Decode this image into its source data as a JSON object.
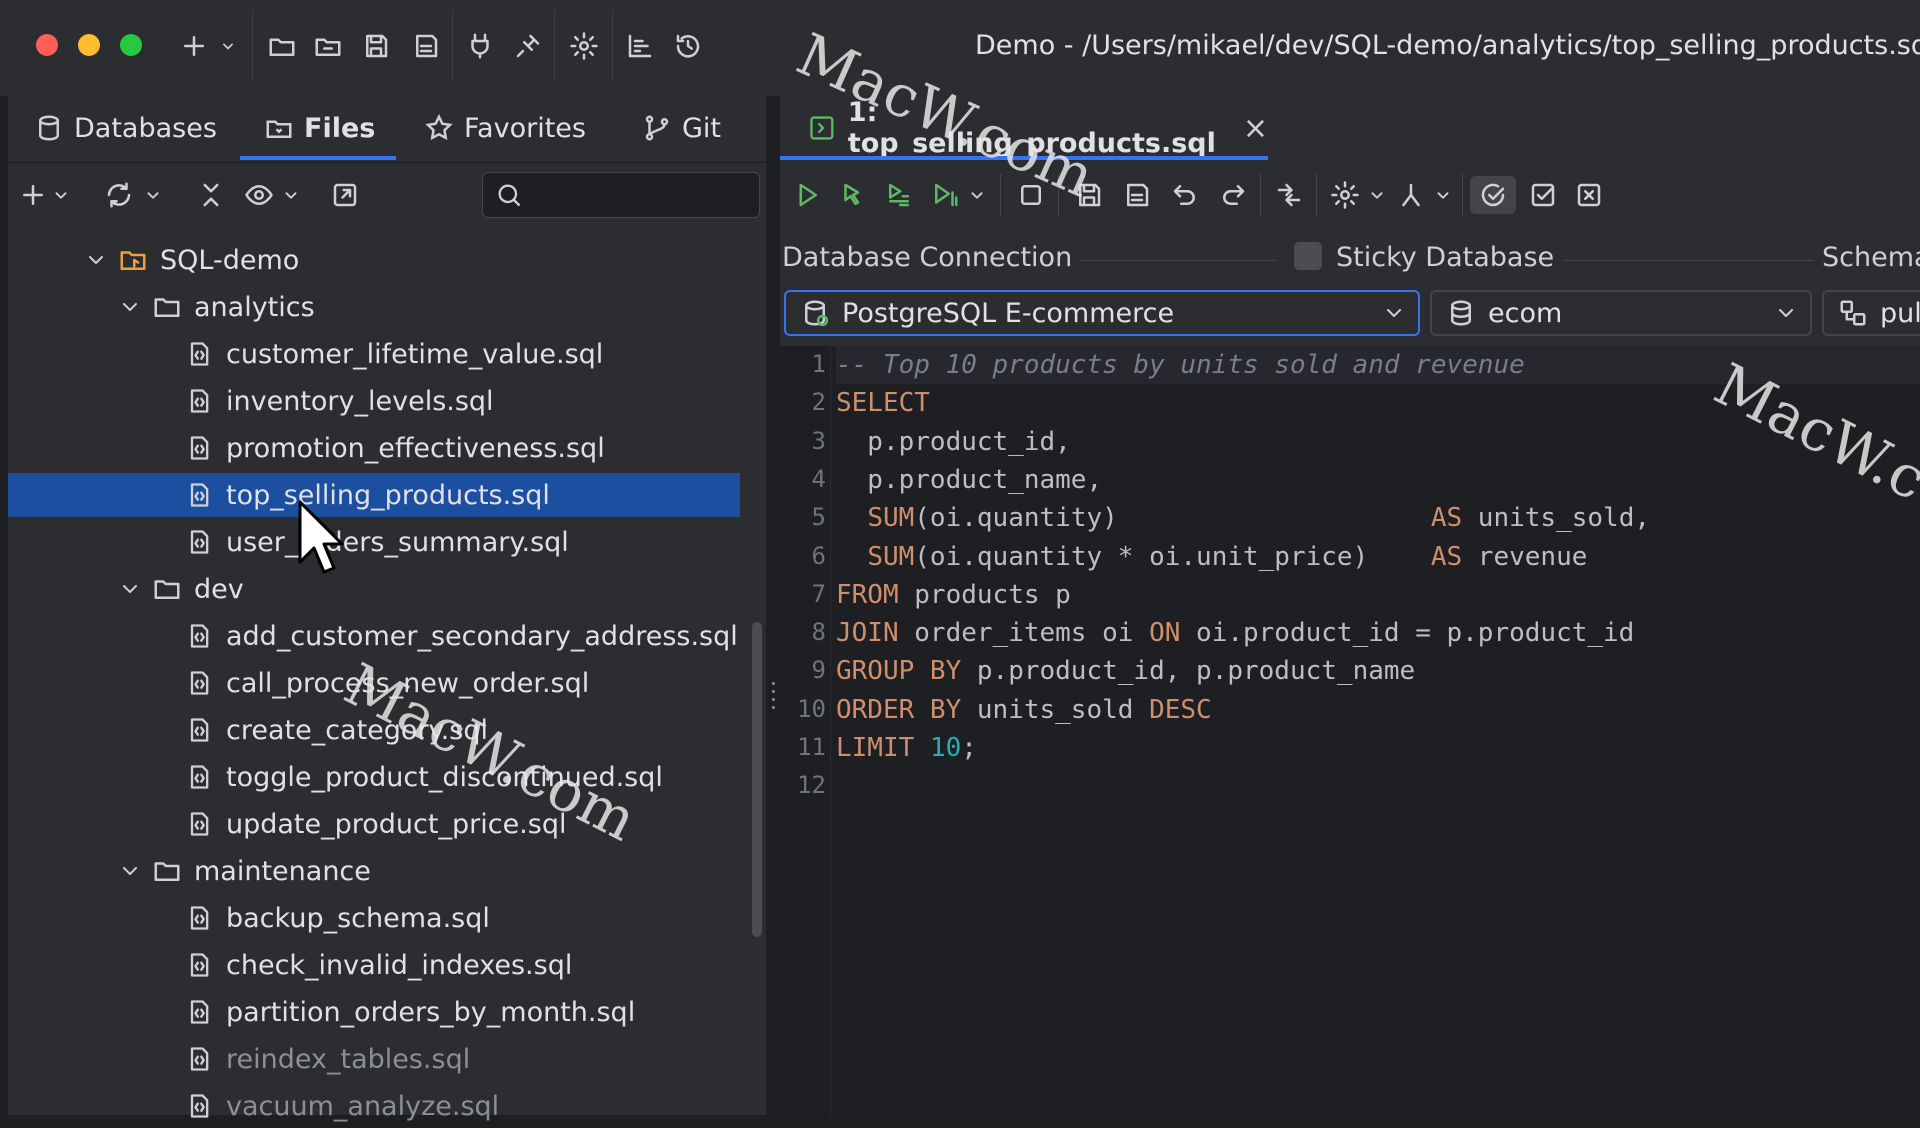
{
  "window": {
    "title_path": "Demo - /Users/mikael/dev/SQL-demo/analytics/top_selling_products.sq"
  },
  "left_panel": {
    "tabs": [
      {
        "label": "Databases",
        "icon": "database-icon"
      },
      {
        "label": "Files",
        "icon": "folder-icon",
        "active": true
      },
      {
        "label": "Favorites",
        "icon": "star-icon"
      },
      {
        "label": "Git",
        "icon": "git-branch-icon"
      }
    ],
    "search": {
      "placeholder": "",
      "value": ""
    },
    "tree": [
      {
        "label": "SQL-demo",
        "type": "project",
        "expanded": true
      },
      {
        "label": "analytics",
        "type": "folder",
        "expanded": true
      },
      {
        "label": "customer_lifetime_value.sql",
        "type": "file"
      },
      {
        "label": "inventory_levels.sql",
        "type": "file"
      },
      {
        "label": "promotion_effectiveness.sql",
        "type": "file"
      },
      {
        "label": "top_selling_products.sql",
        "type": "file",
        "selected": true
      },
      {
        "label": "user_orders_summary.sql",
        "type": "file"
      },
      {
        "label": "dev",
        "type": "folder",
        "expanded": true
      },
      {
        "label": "add_customer_secondary_address.sql",
        "type": "file"
      },
      {
        "label": "call_process_new_order.sql",
        "type": "file"
      },
      {
        "label": "create_category.sql",
        "type": "file"
      },
      {
        "label": "toggle_product_discontinued.sql",
        "type": "file"
      },
      {
        "label": "update_product_price.sql",
        "type": "file"
      },
      {
        "label": "maintenance",
        "type": "folder",
        "expanded": true
      },
      {
        "label": "backup_schema.sql",
        "type": "file"
      },
      {
        "label": "check_invalid_indexes.sql",
        "type": "file"
      },
      {
        "label": "partition_orders_by_month.sql",
        "type": "file"
      },
      {
        "label": "reindex_tables.sql",
        "type": "file"
      },
      {
        "label": "vacuum_analyze.sql",
        "type": "file"
      }
    ]
  },
  "editor": {
    "tab_label": "1: top_selling_products.sql",
    "tab_close": "×",
    "connection": {
      "database_connection_label": "Database Connection",
      "sticky_label": "Sticky Database",
      "schema_label": "Schema",
      "connection_value": "PostgreSQL E-commerce",
      "database_value": "ecom",
      "schema_value": "pul"
    },
    "line_numbers": [
      "1",
      "2",
      "3",
      "4",
      "5",
      "6",
      "7",
      "8",
      "9",
      "10",
      "11",
      "12"
    ],
    "code_lines": [
      "-- Top 10 products by units sold and revenue",
      "SELECT",
      "  p.product_id,",
      "  p.product_name,",
      "  SUM(oi.quantity)                    AS units_sold,",
      "  SUM(oi.quantity * oi.unit_price)    AS revenue",
      "FROM products p",
      "JOIN order_items oi ON oi.product_id = p.product_id",
      "GROUP BY p.product_id, p.product_name",
      "ORDER BY units_sold DESC",
      "LIMIT 10;",
      ""
    ]
  },
  "watermarks": [
    "MacW.com",
    "MacW.com",
    "MacW.c"
  ],
  "colors": {
    "selection": "#1d4fa0",
    "accent": "#3574f0",
    "keyword": "#cf8e6d",
    "number": "#2aacb8",
    "run_green": "#5fb865"
  }
}
